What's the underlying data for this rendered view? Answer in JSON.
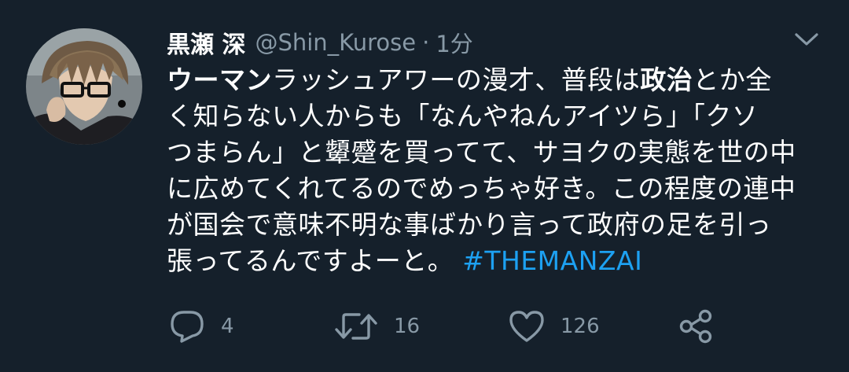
{
  "tweet": {
    "display_name": "黒瀬 深",
    "handle": "@Shin_Kurose",
    "separator": "·",
    "time": "1分",
    "text_lines": [
      {
        "bold": "ウーマン",
        "rest": "ラッシュアワーの漫才、普段は",
        "bold2": "政治",
        "rest2": "とか全"
      },
      {
        "rest": "く知らない人からも「なんやねんアイツら」「クソ"
      },
      {
        "rest": "つまらん」と顰蹙を買ってて、サヨクの実態を世の中"
      },
      {
        "rest": "に広めてくれてるのでめっちゃ好き。この程度の連中"
      },
      {
        "rest": "が国会で意味不明な事ばかり言って政府の足を引っ"
      },
      {
        "rest": "張ってるんですよーと。 ",
        "hashtag": "#THEMANZAI"
      }
    ],
    "actions": {
      "reply_count": "4",
      "retweet_count": "16",
      "like_count": "126"
    }
  },
  "colors": {
    "background": "#15202b",
    "text_primary": "#ffffff",
    "text_secondary": "#8899a6",
    "accent": "#1da1f2"
  },
  "icons": {
    "more": "chevron-down-icon",
    "reply": "reply-icon",
    "retweet": "retweet-icon",
    "like": "heart-icon",
    "share": "share-icon"
  }
}
